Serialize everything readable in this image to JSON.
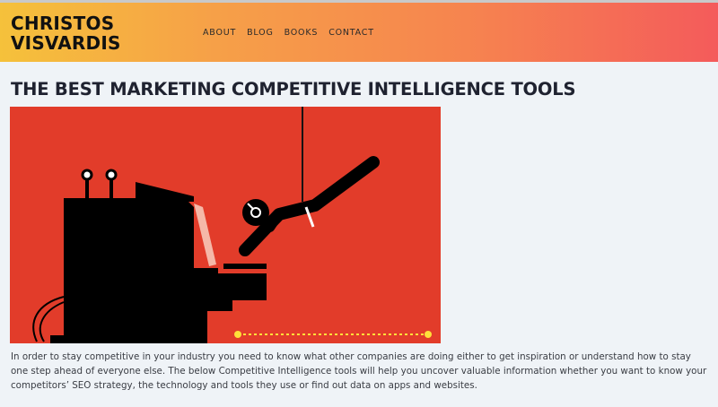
{
  "site": {
    "logo_line1": "CHRISTOS",
    "logo_line2": "VISVARDIS"
  },
  "nav": {
    "items": [
      "ABOUT",
      "BLOG",
      "BOOKS",
      "CONTACT"
    ]
  },
  "article": {
    "title": "THE BEST MARKETING COMPETITIVE INTELLIGENCE TOOLS",
    "hero_image": "robot-hand-typing-on-computer-illustration",
    "intro": "In order to stay competitive in your industry you need to know what other companies are doing either to get inspiration or understand how to stay one step ahead of everyone else. The below Competitive Intelligence tools will help you uncover valuable information whether you want to know your competitors’ SEO strategy, the technology and tools they use or find out data on apps and websites."
  },
  "colors": {
    "header_gradient_start": "#f5c13b",
    "header_gradient_end": "#f45b5b",
    "hero_background": "#e23c2a",
    "page_background": "#eff3f7"
  }
}
